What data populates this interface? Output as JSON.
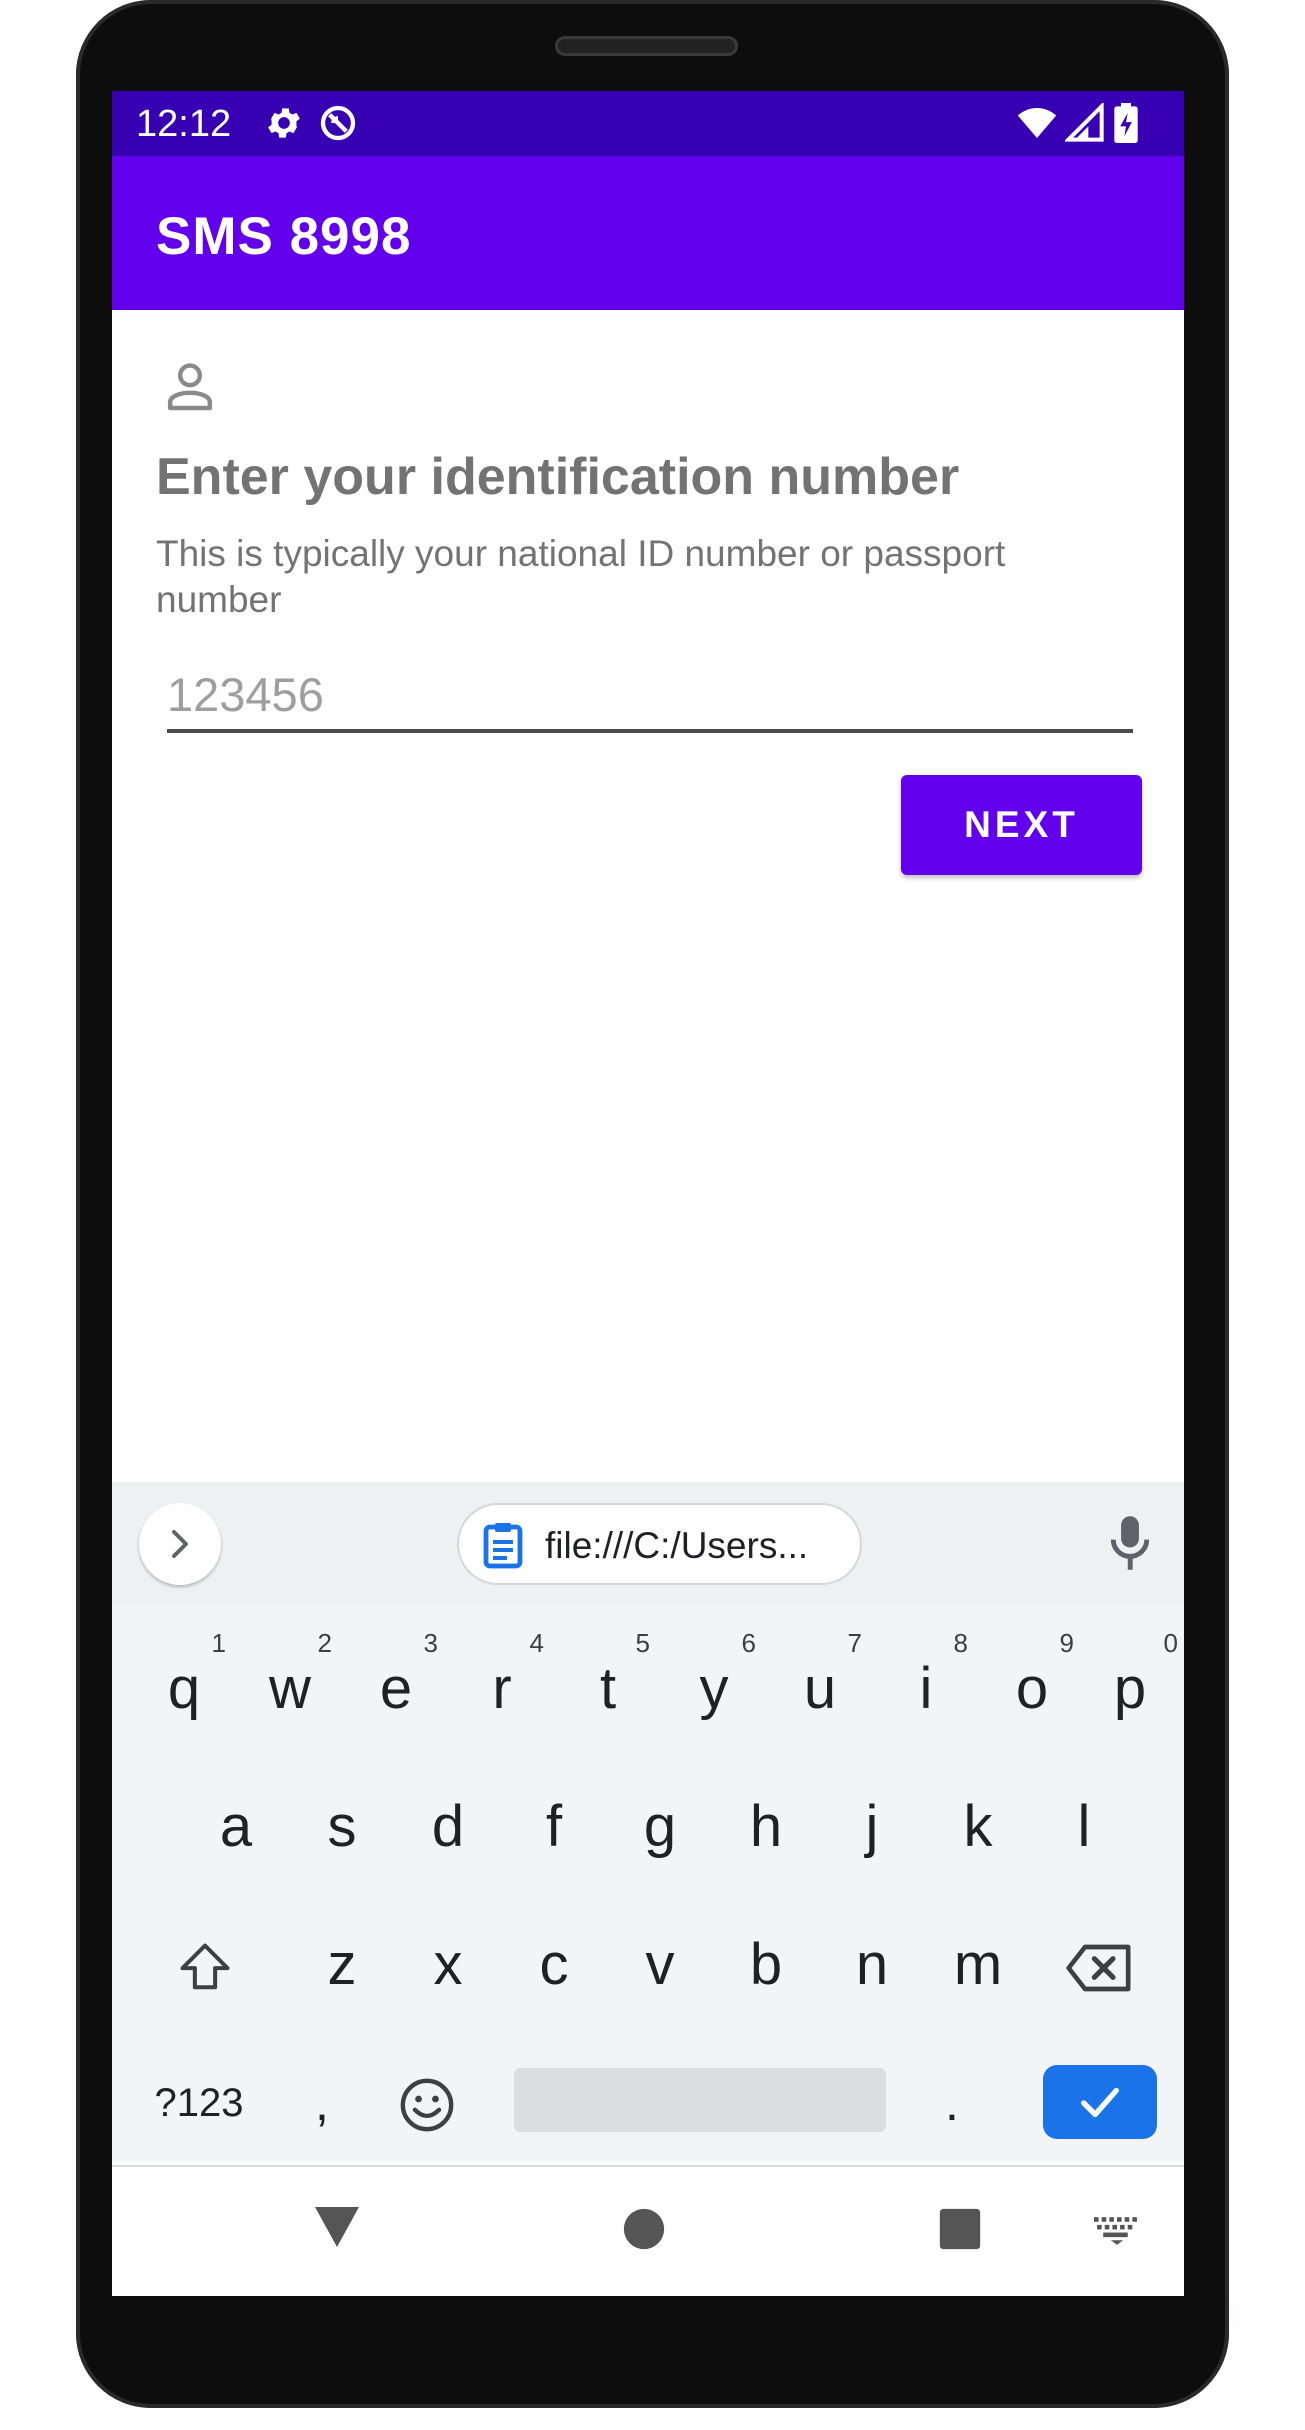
{
  "status_bar": {
    "time": "12:12"
  },
  "app_bar": {
    "title": "SMS 8998"
  },
  "form": {
    "heading": "Enter your identification number",
    "subtext": "This is typically your national ID number or passport number",
    "input_value": "",
    "input_placeholder": "123456",
    "next_label": "NEXT"
  },
  "keyboard": {
    "clipboard_text": "file:///C:/Users...",
    "row1": [
      "q",
      "w",
      "e",
      "r",
      "t",
      "y",
      "u",
      "i",
      "o",
      "p"
    ],
    "row1_hints": [
      "1",
      "2",
      "3",
      "4",
      "5",
      "6",
      "7",
      "8",
      "9",
      "0"
    ],
    "row2": [
      "a",
      "s",
      "d",
      "f",
      "g",
      "h",
      "j",
      "k",
      "l"
    ],
    "row3": [
      "z",
      "x",
      "c",
      "v",
      "b",
      "n",
      "m"
    ],
    "symbols_label": "?123",
    "comma": ",",
    "period": "."
  },
  "colors": {
    "status_bar": "#3700b3",
    "app_bar": "#6200ee",
    "accent": "#6200ee",
    "enter_key": "#1a73e8"
  },
  "icons": [
    "settings-icon",
    "sync-icon",
    "wifi-icon",
    "signal-icon",
    "battery-icon",
    "person-icon",
    "chevron-right-icon",
    "clipboard-icon",
    "microphone-icon",
    "shift-icon",
    "backspace-icon",
    "emoji-icon",
    "check-icon",
    "back-triangle-icon",
    "home-circle-icon",
    "recents-square-icon",
    "keyboard-icon"
  ]
}
